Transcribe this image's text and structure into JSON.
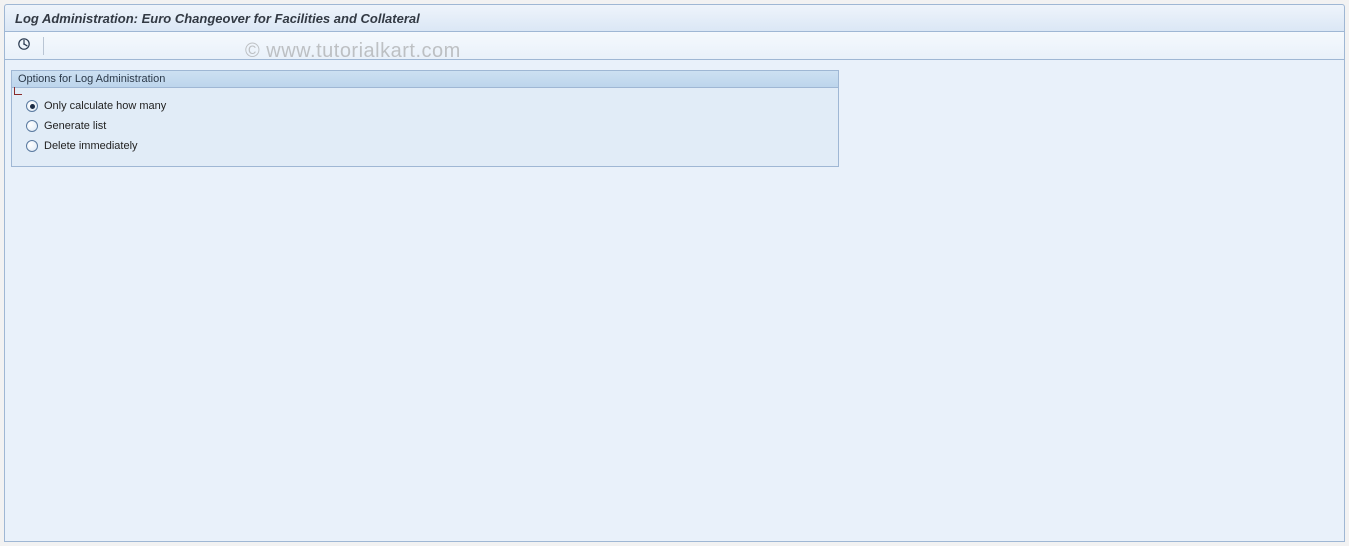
{
  "header": {
    "title": "Log Administration: Euro Changeover for Facilities and Collateral"
  },
  "toolbar": {
    "execute_icon": "execute-icon"
  },
  "group": {
    "title": "Options for Log Administration",
    "options": [
      {
        "label": "Only calculate how many",
        "selected": true
      },
      {
        "label": "Generate list",
        "selected": false
      },
      {
        "label": "Delete immediately",
        "selected": false
      }
    ]
  },
  "watermark": "© www.tutorialkart.com"
}
